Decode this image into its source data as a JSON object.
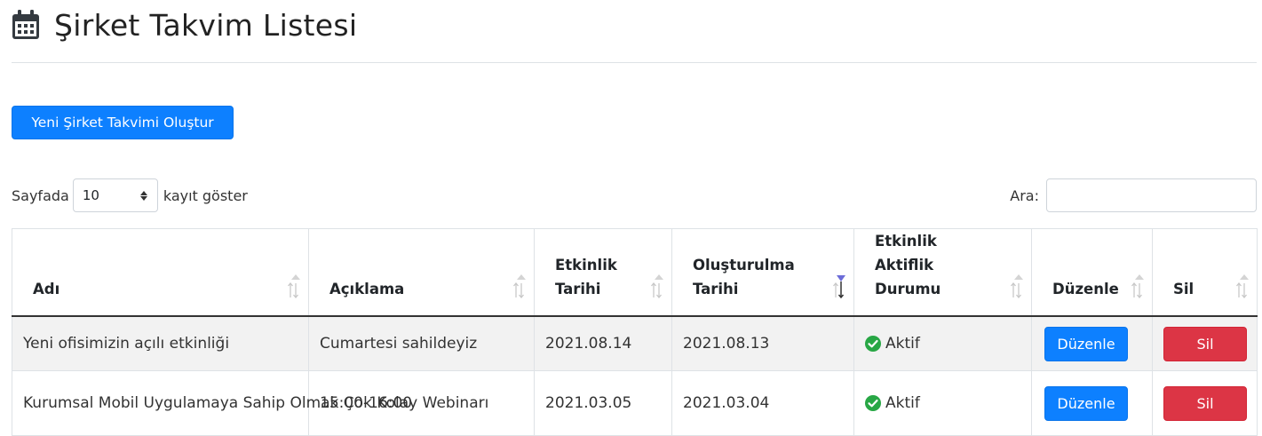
{
  "page": {
    "title": "Şirket Takvim Listesi",
    "icon": "calendar-icon"
  },
  "actions": {
    "create_label": "Yeni Şirket Takvimi Oluştur"
  },
  "length": {
    "prefix": "Sayfada",
    "value": "10",
    "suffix": "kayıt göster"
  },
  "search": {
    "label": "Ara:",
    "value": ""
  },
  "table": {
    "columns": [
      "Adı",
      "Açıklama",
      "Etkinlik Tarihi",
      "Oluşturulma Tarihi",
      "Etkinlik Aktiflik Durumu",
      "Düzenle",
      "Sil"
    ],
    "sorted_column": "Oluşturulma Tarihi",
    "rows": [
      {
        "name": "Yeni ofisimizin açılı etkinliği",
        "description": "Cumartesi sahildeyiz",
        "event_date": "2021.08.14",
        "created_date": "2021.08.13",
        "status": "Aktif",
        "edit": "Düzenle",
        "delete": "Sil"
      },
      {
        "name": "Kurumsal Mobil Uygulamaya Sahip Olmak Çok Kolay Webinarı",
        "description": "15:00-16:00",
        "event_date": "2021.03.05",
        "created_date": "2021.03.04",
        "status": "Aktif",
        "edit": "Düzenle",
        "delete": "Sil"
      }
    ]
  },
  "colors": {
    "primary": "#0d80ff",
    "danger": "#dc3545",
    "success": "#28a745",
    "sort_active": "#6c6cd8"
  }
}
